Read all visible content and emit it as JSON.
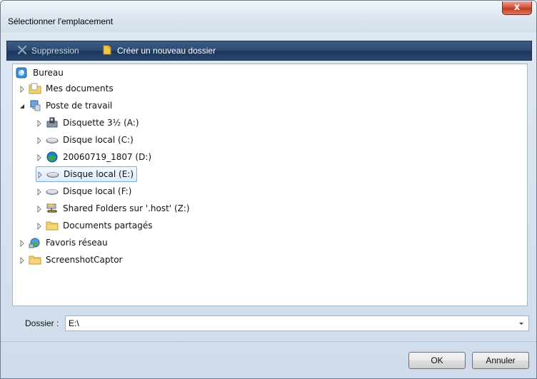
{
  "window": {
    "title": "Sélectionner l'emplacement",
    "close_label": "x"
  },
  "toolbar": {
    "delete_label": "Suppression",
    "new_folder_label": "Créer un nouveau dossier"
  },
  "tree": {
    "items": [
      {
        "label": "Bureau",
        "icon": "desktop-icon"
      },
      {
        "label": "Mes documents",
        "icon": "documents-folder-icon"
      },
      {
        "label": "Poste de travail",
        "icon": "computer-icon"
      },
      {
        "label": "Disquette 3½ (A:)",
        "icon": "floppy-drive-icon"
      },
      {
        "label": "Disque local (C:)",
        "icon": "hard-drive-icon"
      },
      {
        "label": "20060719_1807 (D:)",
        "icon": "optical-drive-icon"
      },
      {
        "label": "Disque local (E:)",
        "icon": "hard-drive-icon",
        "selected": true
      },
      {
        "label": "Disque local (F:)",
        "icon": "hard-drive-icon"
      },
      {
        "label": "Shared Folders sur '.host' (Z:)",
        "icon": "network-drive-icon"
      },
      {
        "label": "Documents partagés",
        "icon": "folder-icon"
      },
      {
        "label": "Favoris réseau",
        "icon": "network-places-icon"
      },
      {
        "label": "ScreenshotCaptor",
        "icon": "folder-icon"
      }
    ]
  },
  "folder": {
    "label": "Dossier :",
    "value": "E:\\"
  },
  "buttons": {
    "ok_label": "OK",
    "cancel_label": "Annuler"
  }
}
